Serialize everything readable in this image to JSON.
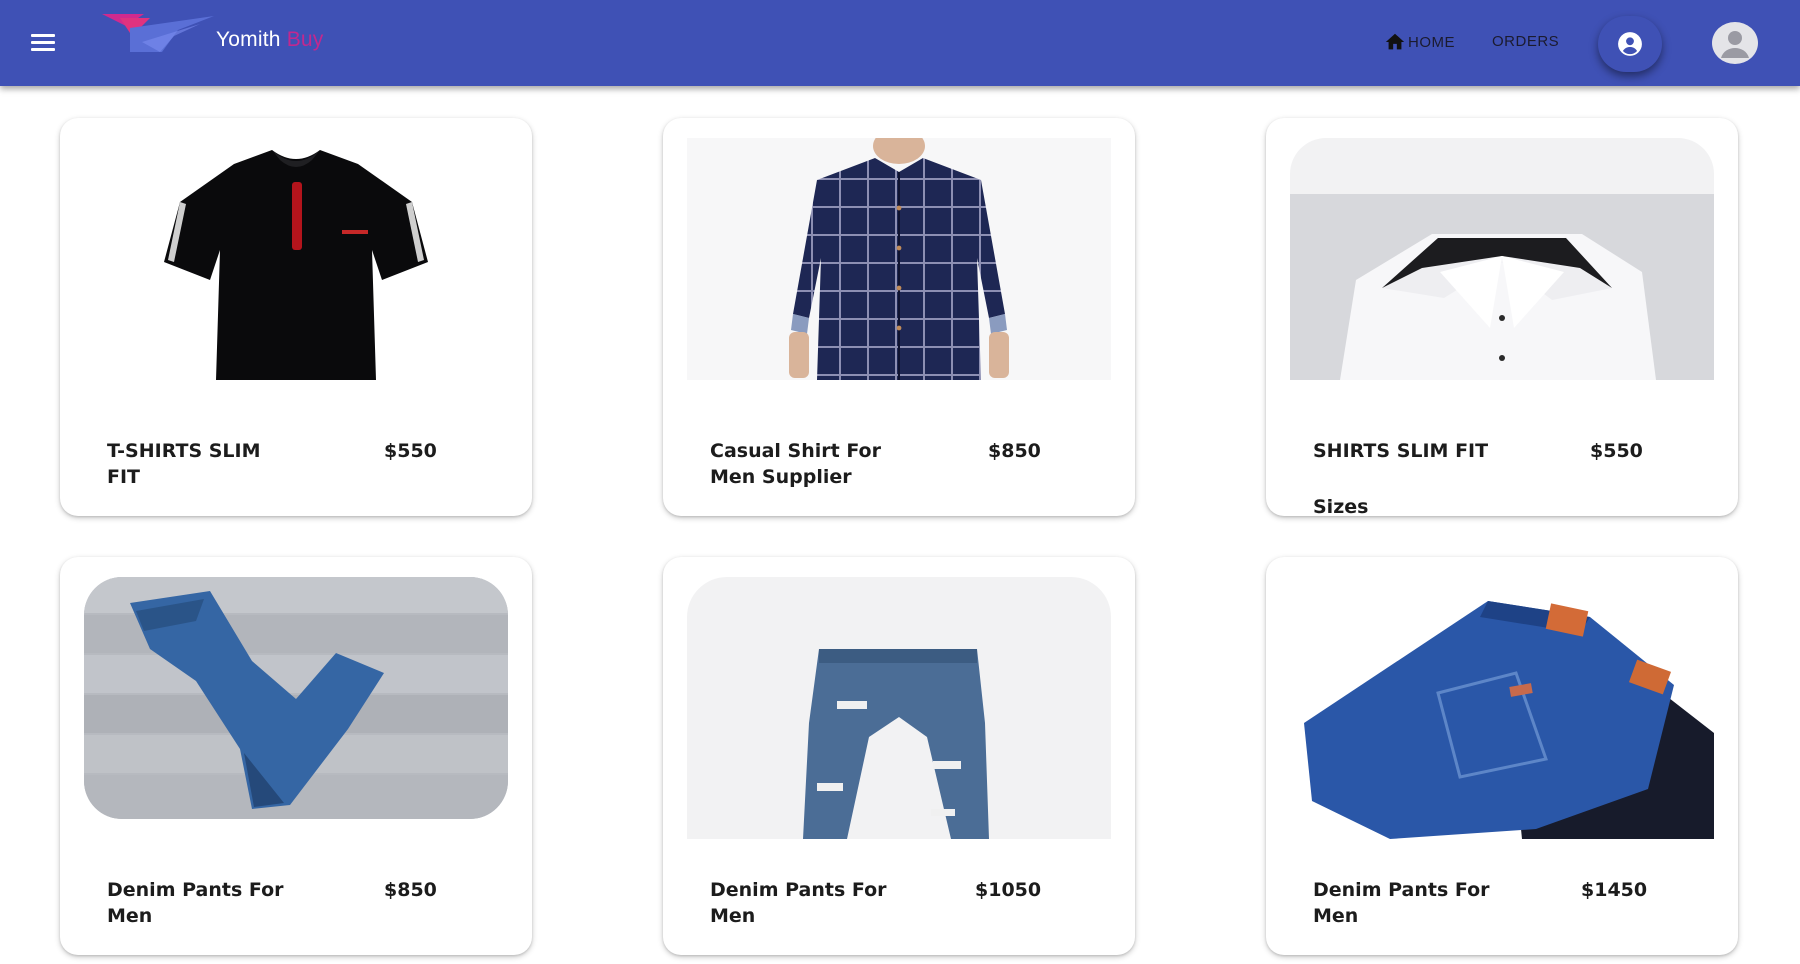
{
  "header": {
    "brand_primary": "Yomith",
    "brand_secondary": "Buy",
    "nav_home": "HOME",
    "nav_orders": "ORDERS",
    "bg_color": "#3f51b5",
    "accent_color": "#c2288f",
    "icons": [
      "menu-icon",
      "logo",
      "home-icon",
      "account-circle-icon",
      "avatar"
    ]
  },
  "products": [
    {
      "title": "T-SHIRTS SLIM FIT",
      "price": "$550"
    },
    {
      "title": "Casual Shirt For Men Supplier",
      "price": "$850"
    },
    {
      "title": "SHIRTS SLIM FIT",
      "price": "$550",
      "extra": "Sizes"
    },
    {
      "title": "Denim Pants For Men",
      "price": "$850"
    },
    {
      "title": "Denim Pants For Men",
      "price": "$1050"
    },
    {
      "title": "Denim Pants For Men",
      "price": "$1450"
    }
  ]
}
